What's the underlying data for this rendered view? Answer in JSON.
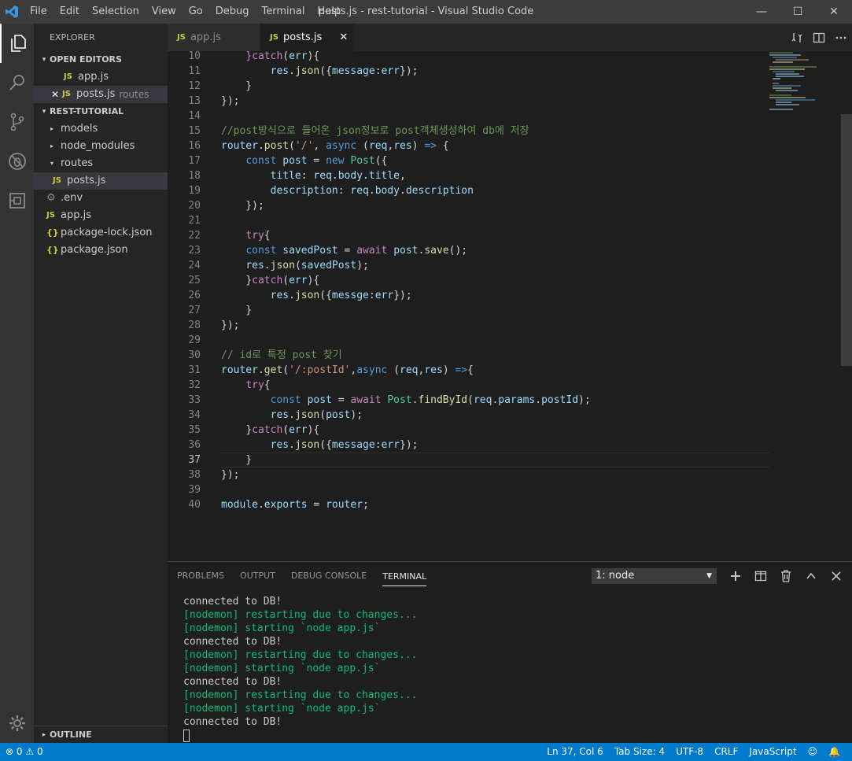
{
  "window": {
    "title": "posts.js - rest-tutorial - Visual Studio Code",
    "logo": "vscode-logo",
    "controls": {
      "minimize": "—",
      "maximize": "☐",
      "close": "✕"
    }
  },
  "menu": [
    "File",
    "Edit",
    "Selection",
    "View",
    "Go",
    "Debug",
    "Terminal",
    "Help"
  ],
  "activity_bar": {
    "icons": [
      "files-icon",
      "search-icon",
      "source-control-icon",
      "debug-icon",
      "extensions-icon"
    ],
    "bottom_icon": "gear-icon"
  },
  "sidebar": {
    "title": "EXPLORER",
    "open_editors": {
      "header": "OPEN EDITORS",
      "items": [
        {
          "icon": "JS",
          "name": "app.js",
          "desc": ""
        },
        {
          "icon": "JS",
          "name": "posts.js",
          "desc": "routes",
          "close": "✕"
        }
      ]
    },
    "project": {
      "header": "REST-TUTORIAL",
      "items": [
        {
          "type": "folder",
          "name": "models",
          "tw": "▸"
        },
        {
          "type": "folder",
          "name": "node_modules",
          "tw": "▸"
        },
        {
          "type": "folder",
          "name": "routes",
          "tw": "▾"
        },
        {
          "type": "file",
          "icon": "JS",
          "name": "posts.js"
        },
        {
          "type": "file",
          "icon": "⚙",
          "name": ".env"
        },
        {
          "type": "file",
          "icon": "JS",
          "name": "app.js"
        },
        {
          "type": "file",
          "icon": "{}",
          "name": "package-lock.json"
        },
        {
          "type": "file",
          "icon": "{}",
          "name": "package.json"
        }
      ]
    },
    "outline": {
      "header": "OUTLINE",
      "tw": "▸"
    }
  },
  "tabs": [
    {
      "icon": "JS",
      "label": "app.js",
      "active": false
    },
    {
      "icon": "JS",
      "label": "posts.js",
      "active": true,
      "close": "✕"
    }
  ],
  "editor": {
    "current_line": 37,
    "lines": [
      {
        "n": "10",
        "code": [
          [
            "    ",
            "p"
          ],
          [
            "}",
            "kc"
          ],
          [
            "catch",
            "kc"
          ],
          [
            "(",
            "p"
          ],
          [
            "err",
            "v"
          ],
          [
            "){",
            "p"
          ]
        ]
      },
      {
        "n": "11",
        "code": [
          [
            "        ",
            "p"
          ],
          [
            "res",
            "v"
          ],
          [
            ".",
            "p"
          ],
          [
            "json",
            "f"
          ],
          [
            "({",
            "p"
          ],
          [
            "message",
            "v"
          ],
          [
            ":",
            "p"
          ],
          [
            "err",
            "v"
          ],
          [
            "});",
            "p"
          ]
        ]
      },
      {
        "n": "12",
        "code": [
          [
            "    }",
            "p"
          ]
        ]
      },
      {
        "n": "13",
        "code": [
          [
            "});",
            "p"
          ]
        ]
      },
      {
        "n": "14",
        "code": []
      },
      {
        "n": "15",
        "code": [
          [
            "//post방식으로 들어온 json정보로 post객체생성하여 db에 저장",
            "c"
          ]
        ]
      },
      {
        "n": "16",
        "code": [
          [
            "router",
            "v"
          ],
          [
            ".",
            "p"
          ],
          [
            "post",
            "f"
          ],
          [
            "(",
            "p"
          ],
          [
            "'/'",
            "s"
          ],
          [
            ", ",
            "p"
          ],
          [
            "async",
            "k"
          ],
          [
            " (",
            "p"
          ],
          [
            "req",
            "v"
          ],
          [
            ",",
            "p"
          ],
          [
            "res",
            "v"
          ],
          [
            ") ",
            "p"
          ],
          [
            "=>",
            "k"
          ],
          [
            " {",
            "p"
          ]
        ]
      },
      {
        "n": "17",
        "code": [
          [
            "    ",
            "p"
          ],
          [
            "const",
            "k"
          ],
          [
            " ",
            "p"
          ],
          [
            "post",
            "v"
          ],
          [
            " = ",
            "p"
          ],
          [
            "new",
            "k"
          ],
          [
            " ",
            "p"
          ],
          [
            "Post",
            "t"
          ],
          [
            "({",
            "p"
          ]
        ]
      },
      {
        "n": "18",
        "code": [
          [
            "        ",
            "p"
          ],
          [
            "title",
            "v"
          ],
          [
            ": ",
            "p"
          ],
          [
            "req",
            "v"
          ],
          [
            ".",
            "p"
          ],
          [
            "body",
            "v"
          ],
          [
            ".",
            "p"
          ],
          [
            "title",
            "v"
          ],
          [
            ",",
            "p"
          ]
        ]
      },
      {
        "n": "19",
        "code": [
          [
            "        ",
            "p"
          ],
          [
            "description",
            "v"
          ],
          [
            ": ",
            "p"
          ],
          [
            "req",
            "v"
          ],
          [
            ".",
            "p"
          ],
          [
            "body",
            "v"
          ],
          [
            ".",
            "p"
          ],
          [
            "description",
            "v"
          ]
        ]
      },
      {
        "n": "20",
        "code": [
          [
            "    });",
            "p"
          ]
        ]
      },
      {
        "n": "21",
        "code": []
      },
      {
        "n": "22",
        "code": [
          [
            "    ",
            "p"
          ],
          [
            "try",
            "kc"
          ],
          [
            "{",
            "p"
          ]
        ]
      },
      {
        "n": "23",
        "code": [
          [
            "    ",
            "p"
          ],
          [
            "const",
            "k"
          ],
          [
            " ",
            "p"
          ],
          [
            "savedPost",
            "v"
          ],
          [
            " = ",
            "p"
          ],
          [
            "await",
            "kc"
          ],
          [
            " ",
            "p"
          ],
          [
            "post",
            "v"
          ],
          [
            ".",
            "p"
          ],
          [
            "save",
            "f"
          ],
          [
            "();",
            "p"
          ]
        ]
      },
      {
        "n": "24",
        "code": [
          [
            "    ",
            "p"
          ],
          [
            "res",
            "v"
          ],
          [
            ".",
            "p"
          ],
          [
            "json",
            "f"
          ],
          [
            "(",
            "p"
          ],
          [
            "savedPost",
            "v"
          ],
          [
            ");",
            "p"
          ]
        ]
      },
      {
        "n": "25",
        "code": [
          [
            "    ",
            "p"
          ],
          [
            "}",
            "p"
          ],
          [
            "catch",
            "kc"
          ],
          [
            "(",
            "p"
          ],
          [
            "err",
            "v"
          ],
          [
            "){",
            "p"
          ]
        ]
      },
      {
        "n": "26",
        "code": [
          [
            "        ",
            "p"
          ],
          [
            "res",
            "v"
          ],
          [
            ".",
            "p"
          ],
          [
            "json",
            "f"
          ],
          [
            "({",
            "p"
          ],
          [
            "messge",
            "v"
          ],
          [
            ":",
            "p"
          ],
          [
            "err",
            "v"
          ],
          [
            "});",
            "p"
          ]
        ]
      },
      {
        "n": "27",
        "code": [
          [
            "    }",
            "p"
          ]
        ]
      },
      {
        "n": "28",
        "code": [
          [
            "});",
            "p"
          ]
        ]
      },
      {
        "n": "29",
        "code": []
      },
      {
        "n": "30",
        "code": [
          [
            "// id로 특정 post 찾기",
            "c"
          ]
        ]
      },
      {
        "n": "31",
        "code": [
          [
            "router",
            "v"
          ],
          [
            ".",
            "p"
          ],
          [
            "get",
            "f"
          ],
          [
            "(",
            "p"
          ],
          [
            "'/:postId'",
            "s"
          ],
          [
            ",",
            "p"
          ],
          [
            "async",
            "k"
          ],
          [
            " (",
            "p"
          ],
          [
            "req",
            "v"
          ],
          [
            ",",
            "p"
          ],
          [
            "res",
            "v"
          ],
          [
            ") ",
            "p"
          ],
          [
            "=>",
            "k"
          ],
          [
            "{",
            "p"
          ]
        ]
      },
      {
        "n": "32",
        "code": [
          [
            "    ",
            "p"
          ],
          [
            "try",
            "kc"
          ],
          [
            "{",
            "p"
          ]
        ]
      },
      {
        "n": "33",
        "code": [
          [
            "        ",
            "p"
          ],
          [
            "const",
            "k"
          ],
          [
            " ",
            "p"
          ],
          [
            "post",
            "v"
          ],
          [
            " = ",
            "p"
          ],
          [
            "await",
            "kc"
          ],
          [
            " ",
            "p"
          ],
          [
            "Post",
            "t"
          ],
          [
            ".",
            "p"
          ],
          [
            "findById",
            "f"
          ],
          [
            "(",
            "p"
          ],
          [
            "req",
            "v"
          ],
          [
            ".",
            "p"
          ],
          [
            "params",
            "v"
          ],
          [
            ".",
            "p"
          ],
          [
            "postId",
            "v"
          ],
          [
            ");",
            "p"
          ]
        ]
      },
      {
        "n": "34",
        "code": [
          [
            "        ",
            "p"
          ],
          [
            "res",
            "v"
          ],
          [
            ".",
            "p"
          ],
          [
            "json",
            "f"
          ],
          [
            "(",
            "p"
          ],
          [
            "post",
            "v"
          ],
          [
            ");",
            "p"
          ]
        ]
      },
      {
        "n": "35",
        "code": [
          [
            "    ",
            "p"
          ],
          [
            "}",
            "p"
          ],
          [
            "catch",
            "kc"
          ],
          [
            "(",
            "p"
          ],
          [
            "err",
            "v"
          ],
          [
            "){",
            "p"
          ]
        ]
      },
      {
        "n": "36",
        "code": [
          [
            "        ",
            "p"
          ],
          [
            "res",
            "v"
          ],
          [
            ".",
            "p"
          ],
          [
            "json",
            "f"
          ],
          [
            "({",
            "p"
          ],
          [
            "message",
            "v"
          ],
          [
            ":",
            "p"
          ],
          [
            "err",
            "v"
          ],
          [
            "});",
            "p"
          ]
        ]
      },
      {
        "n": "37",
        "code": [
          [
            "    }",
            "p"
          ]
        ]
      },
      {
        "n": "38",
        "code": [
          [
            "});",
            "p"
          ]
        ]
      },
      {
        "n": "39",
        "code": []
      },
      {
        "n": "40",
        "code": [
          [
            "module",
            "v"
          ],
          [
            ".",
            "p"
          ],
          [
            "exports",
            "v"
          ],
          [
            " = ",
            "p"
          ],
          [
            "router",
            "v"
          ],
          [
            ";",
            "p"
          ]
        ]
      }
    ]
  },
  "panel": {
    "tabs": [
      {
        "label": "PROBLEMS",
        "active": false
      },
      {
        "label": "OUTPUT",
        "active": false
      },
      {
        "label": "DEBUG CONSOLE",
        "active": false
      },
      {
        "label": "TERMINAL",
        "active": true
      }
    ],
    "terminal_select": "1: node",
    "select_caret": "▼",
    "actions": {
      "new": "+",
      "split": "◫",
      "trash": "🗑",
      "maximize": "∧",
      "close": "✕"
    },
    "terminal_lines": [
      {
        "text": "connected to DB!",
        "green": false
      },
      {
        "text": "[nodemon] restarting due to changes...",
        "green": true
      },
      {
        "text": "[nodemon] starting `node app.js`",
        "green": true
      },
      {
        "text": "connected to DB!",
        "green": false
      },
      {
        "text": "[nodemon] restarting due to changes...",
        "green": true
      },
      {
        "text": "[nodemon] starting `node app.js`",
        "green": true
      },
      {
        "text": "connected to DB!",
        "green": false
      },
      {
        "text": "[nodemon] restarting due to changes...",
        "green": true
      },
      {
        "text": "[nodemon] starting `node app.js`",
        "green": true
      },
      {
        "text": "connected to DB!",
        "green": false
      }
    ]
  },
  "statusbar": {
    "errors_icon": "⊗",
    "errors": "0",
    "warnings_icon": "⚠",
    "warnings": "0",
    "position": "Ln 37, Col 6",
    "tab_size": "Tab Size: 4",
    "encoding": "UTF-8",
    "eol": "CRLF",
    "language": "JavaScript",
    "feedback_icon": "☺",
    "bell_icon": "🔔"
  },
  "colors": {
    "accent": "#007acc",
    "editor_bg": "#1e1e1e",
    "sidebar_bg": "#252526",
    "activity_bg": "#333333",
    "titlebar_bg": "#3c3c3c",
    "js_icon": "#cbcb41",
    "terminal_green": "#0dbc79"
  }
}
